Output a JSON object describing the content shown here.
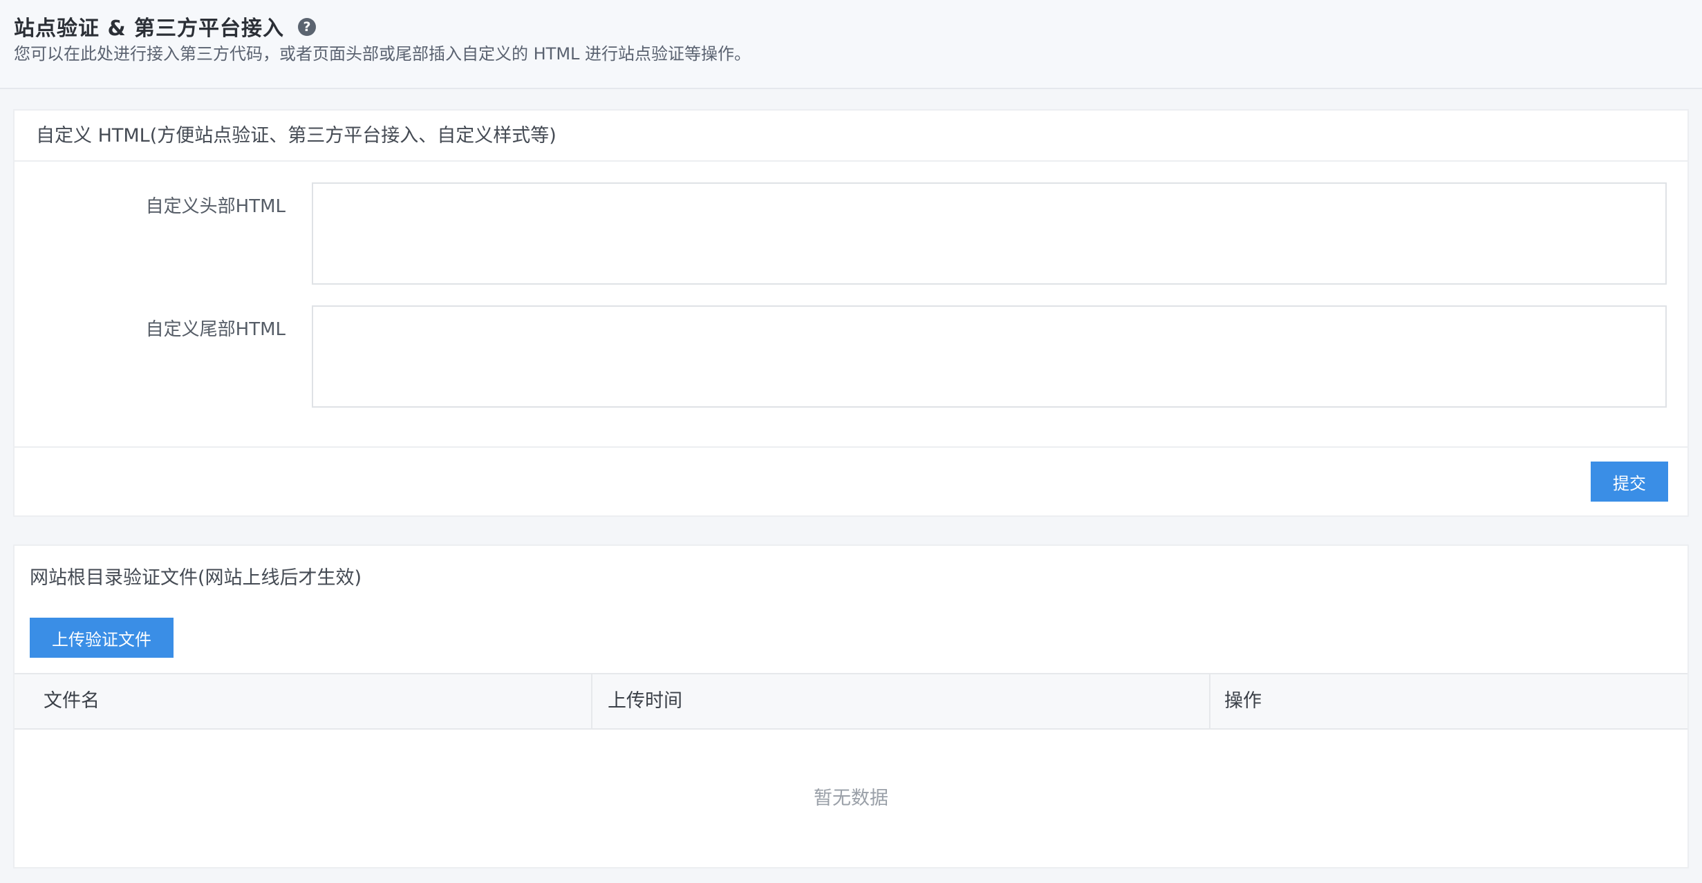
{
  "header": {
    "title": "站点验证 & 第三方平台接入",
    "help_icon": "question-circle-icon",
    "subtitle": "您可以在此处进行接入第三方代码，或者页面头部或尾部插入自定义的 HTML 进行站点验证等操作。"
  },
  "custom_html": {
    "card_title": "自定义 HTML(方便站点验证、第三方平台接入、自定义样式等)",
    "head_label": "自定义头部HTML",
    "head_value": "",
    "foot_label": "自定义尾部HTML",
    "foot_value": "",
    "submit_label": "提交"
  },
  "verify_files": {
    "card_title": "网站根目录验证文件(网站上线后才生效)",
    "upload_label": "上传验证文件",
    "columns": [
      "文件名",
      "上传时间",
      "操作"
    ],
    "rows": [],
    "empty_text": "暂无数据"
  },
  "colors": {
    "primary": "#3a8ee6",
    "page_bg": "#f4f6f9"
  }
}
